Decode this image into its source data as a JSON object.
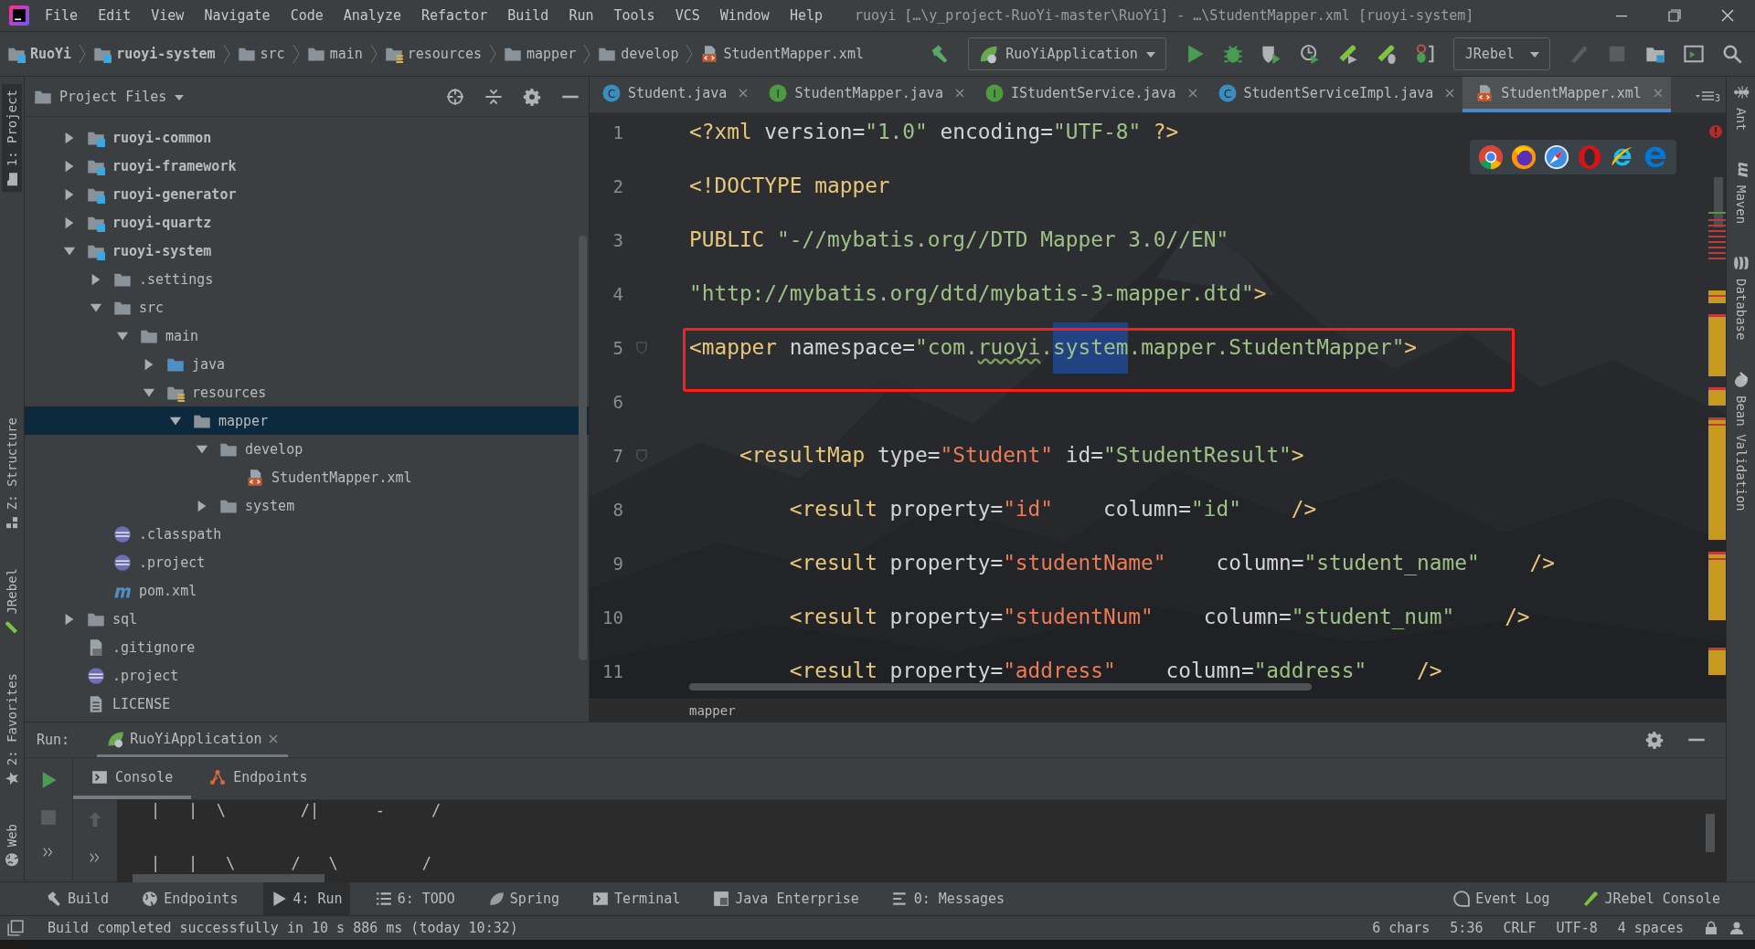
{
  "window": {
    "title": "ruoyi […\\y_project-RuoYi-master\\RuoYi] - …\\StudentMapper.xml [ruoyi-system]"
  },
  "menu": [
    "File",
    "Edit",
    "View",
    "Navigate",
    "Code",
    "Analyze",
    "Refactor",
    "Build",
    "Run",
    "Tools",
    "VCS",
    "Window",
    "Help"
  ],
  "breadcrumbs": [
    {
      "label": "RuoYi",
      "kind": "module"
    },
    {
      "label": "ruoyi-system",
      "kind": "module"
    },
    {
      "label": "src",
      "kind": "folder"
    },
    {
      "label": "main",
      "kind": "folder"
    },
    {
      "label": "resources",
      "kind": "resources"
    },
    {
      "label": "mapper",
      "kind": "folder"
    },
    {
      "label": "develop",
      "kind": "folder"
    },
    {
      "label": "StudentMapper.xml",
      "kind": "xml"
    }
  ],
  "toolbar": {
    "run_config": "RuoYiApplication",
    "jrebel_config": "JRebel"
  },
  "left_stripe": [
    {
      "label": "1: Project",
      "kind": "project",
      "selected": true
    },
    {
      "label": "Z: Structure",
      "kind": "structure",
      "selected": false
    },
    {
      "label": "JRebel",
      "kind": "jrebel",
      "selected": false
    },
    {
      "label": "2: Favorites",
      "kind": "favorites",
      "selected": false
    },
    {
      "label": "Web",
      "kind": "web",
      "selected": false
    }
  ],
  "project_panel": {
    "title": "Project Files",
    "tree": [
      {
        "label": "ruoyi-common",
        "kind": "module",
        "expanded": false,
        "selected": false
      },
      {
        "label": "ruoyi-framework",
        "kind": "module",
        "expanded": false,
        "selected": false
      },
      {
        "label": "ruoyi-generator",
        "kind": "module",
        "expanded": false,
        "selected": false
      },
      {
        "label": "ruoyi-quartz",
        "kind": "module",
        "expanded": false,
        "selected": false
      },
      {
        "label": "ruoyi-system",
        "kind": "module",
        "expanded": true,
        "selected": false,
        "children": [
          {
            "label": ".settings",
            "kind": "folder",
            "expanded": false,
            "selected": false
          },
          {
            "label": "src",
            "kind": "folder",
            "expanded": true,
            "selected": false,
            "children": [
              {
                "label": "main",
                "kind": "folder",
                "expanded": true,
                "selected": false,
                "children": [
                  {
                    "label": "java",
                    "kind": "source",
                    "expanded": false,
                    "selected": false
                  },
                  {
                    "label": "resources",
                    "kind": "resources",
                    "expanded": true,
                    "selected": false,
                    "children": [
                      {
                        "label": "mapper",
                        "kind": "folder",
                        "expanded": true,
                        "selected": true,
                        "children": [
                          {
                            "label": "develop",
                            "kind": "folder",
                            "expanded": true,
                            "selected": false,
                            "children": [
                              {
                                "label": "StudentMapper.xml",
                                "kind": "xml",
                                "selected": false
                              }
                            ]
                          },
                          {
                            "label": "system",
                            "kind": "folder",
                            "expanded": false,
                            "selected": false
                          }
                        ]
                      }
                    ]
                  }
                ]
              }
            ]
          },
          {
            "label": ".classpath",
            "kind": "eclipse",
            "selected": false
          },
          {
            "label": ".project",
            "kind": "eclipse",
            "selected": false
          },
          {
            "label": "pom.xml",
            "kind": "maven",
            "selected": false
          }
        ]
      },
      {
        "label": "sql",
        "kind": "folder",
        "expanded": false,
        "selected": false
      },
      {
        "label": ".gitignore",
        "kind": "ignore",
        "selected": false
      },
      {
        "label": ".project",
        "kind": "eclipse",
        "selected": false
      },
      {
        "label": "LICENSE",
        "kind": "license",
        "selected": false
      }
    ]
  },
  "editor": {
    "tabs": [
      {
        "label": "Student.java",
        "kind": "class",
        "badge": "C",
        "selected": false
      },
      {
        "label": "StudentMapper.java",
        "kind": "interface",
        "badge": "I",
        "selected": false
      },
      {
        "label": "IStudentService.java",
        "kind": "interface",
        "badge": "I",
        "selected": false
      },
      {
        "label": "StudentServiceImpl.java",
        "kind": "class",
        "badge": "C",
        "selected": false
      },
      {
        "label": "StudentMapper.xml",
        "kind": "xml",
        "selected": true
      }
    ],
    "hidden_tabs": "3",
    "lines": [
      {
        "number": "1",
        "fold": false,
        "boxed": false,
        "tokens": [
          {
            "text": "<?xml",
            "kind": "tag"
          },
          {
            "text": " version=",
            "kind": "attr"
          },
          {
            "text": "\"1.0\"",
            "kind": "value"
          },
          {
            "text": " encoding=",
            "kind": "attr"
          },
          {
            "text": "\"UTF-8\"",
            "kind": "value"
          },
          {
            "text": " ?>",
            "kind": "tag"
          }
        ]
      },
      {
        "number": "2",
        "fold": false,
        "boxed": false,
        "tokens": [
          {
            "text": "<!DOCTYPE mapper",
            "kind": "tag"
          }
        ]
      },
      {
        "number": "3",
        "fold": false,
        "boxed": false,
        "tokens": [
          {
            "text": "PUBLIC ",
            "kind": "tag"
          },
          {
            "text": "\"-//mybatis.org//DTD Mapper 3.0//EN\"",
            "kind": "value"
          }
        ]
      },
      {
        "number": "4",
        "fold": false,
        "boxed": false,
        "tokens": [
          {
            "text": "\"http://mybatis.org/dtd/mybatis-3-mapper.dtd\"",
            "kind": "value"
          },
          {
            "text": ">",
            "kind": "tag"
          }
        ]
      },
      {
        "number": "5",
        "fold": true,
        "boxed": true,
        "tokens": [
          {
            "text": "<mapper",
            "kind": "tag"
          },
          {
            "text": " namespace=",
            "kind": "attr"
          },
          {
            "text": "\"com.",
            "kind": "value"
          },
          {
            "text": "ruoyi",
            "kind": "typo"
          },
          {
            "text": ".",
            "kind": "value"
          },
          {
            "text": "system",
            "kind": "selection"
          },
          {
            "text": ".mapper.StudentMapper\"",
            "kind": "value"
          },
          {
            "text": ">",
            "kind": "tag"
          }
        ]
      },
      {
        "number": "6",
        "fold": false,
        "boxed": false
      },
      {
        "number": "7",
        "fold": true,
        "boxed": false,
        "tokens": [
          {
            "text": "    <resultMap",
            "kind": "tag"
          },
          {
            "text": " type=",
            "kind": "attr"
          },
          {
            "text": "\"Student\"",
            "kind": "ref"
          },
          {
            "text": " id=",
            "kind": "attr"
          },
          {
            "text": "\"StudentResult\"",
            "kind": "value"
          },
          {
            "text": ">",
            "kind": "tag"
          }
        ]
      },
      {
        "number": "8",
        "fold": false,
        "boxed": false,
        "tokens": [
          {
            "text": "        <result",
            "kind": "tag"
          },
          {
            "text": " property=",
            "kind": "attr"
          },
          {
            "text": "\"id\"",
            "kind": "ref"
          },
          {
            "text": "    column=",
            "kind": "attr"
          },
          {
            "text": "\"id\"",
            "kind": "value"
          },
          {
            "text": "    />",
            "kind": "tag"
          }
        ]
      },
      {
        "number": "9",
        "fold": false,
        "boxed": false,
        "tokens": [
          {
            "text": "        <result",
            "kind": "tag"
          },
          {
            "text": " property=",
            "kind": "attr"
          },
          {
            "text": "\"studentName\"",
            "kind": "ref"
          },
          {
            "text": "    column=",
            "kind": "attr"
          },
          {
            "text": "\"student_name\"",
            "kind": "value"
          },
          {
            "text": "    />",
            "kind": "tag"
          }
        ]
      },
      {
        "number": "10",
        "fold": false,
        "boxed": false,
        "tokens": [
          {
            "text": "        <result",
            "kind": "tag"
          },
          {
            "text": " property=",
            "kind": "attr"
          },
          {
            "text": "\"studentNum\"",
            "kind": "ref"
          },
          {
            "text": "    column=",
            "kind": "attr"
          },
          {
            "text": "\"student_num\"",
            "kind": "value"
          },
          {
            "text": "    />",
            "kind": "tag"
          }
        ]
      },
      {
        "number": "11",
        "fold": false,
        "boxed": false,
        "tokens": [
          {
            "text": "        <result",
            "kind": "tag"
          },
          {
            "text": " property=",
            "kind": "attr"
          },
          {
            "text": "\"address\"",
            "kind": "ref"
          },
          {
            "text": "    column=",
            "kind": "attr"
          },
          {
            "text": "\"address\"",
            "kind": "value"
          },
          {
            "text": "    />",
            "kind": "tag"
          }
        ]
      }
    ],
    "breadcrumb": "mapper"
  },
  "right_stripe": [
    {
      "label": "Ant",
      "kind": "ant"
    },
    {
      "label": "Maven",
      "kind": "maven"
    },
    {
      "label": "Database",
      "kind": "database"
    },
    {
      "label": "Bean Validation",
      "kind": "bean"
    }
  ],
  "run_panel": {
    "label": "Run:",
    "tabs": [
      {
        "label": "RuoYiApplication",
        "selected": true
      }
    ],
    "subtabs": [
      {
        "label": "Console",
        "kind": "console",
        "selected": true
      },
      {
        "label": "Endpoints",
        "kind": "endpoints",
        "selected": false
      }
    ],
    "console": [
      "|   |  \\        /|      -     /",
      "|   |   \\      /   \\         /"
    ]
  },
  "tool_windows": {
    "left": [
      {
        "label": "Build",
        "kind": "build",
        "selected": false
      },
      {
        "label": "Endpoints",
        "kind": "endpoints",
        "selected": false
      },
      {
        "label": "4: Run",
        "kind": "run",
        "selected": true
      },
      {
        "label": "6: TODO",
        "kind": "todo",
        "selected": false
      },
      {
        "label": "Spring",
        "kind": "spring",
        "selected": false
      },
      {
        "label": "Terminal",
        "kind": "terminal",
        "selected": false
      },
      {
        "label": "Java Enterprise",
        "kind": "javaee",
        "selected": false
      },
      {
        "label": "0: Messages",
        "kind": "messages",
        "selected": false
      }
    ],
    "right": [
      {
        "label": "Event Log",
        "kind": "eventlog",
        "selected": false
      },
      {
        "label": "JRebel Console",
        "kind": "jrebel",
        "selected": false
      }
    ]
  },
  "status_bar": {
    "message": "Build completed successfully in 10 s 886 ms (today 10:32)",
    "items": [
      "6 chars",
      "5:36",
      "CRLF",
      "UTF-8",
      "4 spaces"
    ]
  }
}
